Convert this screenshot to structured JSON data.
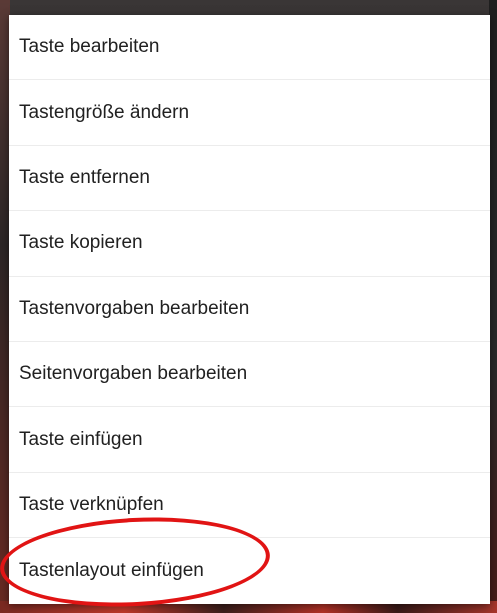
{
  "menu": {
    "items": [
      {
        "label": "Taste bearbeiten"
      },
      {
        "label": "Tastengröße ändern"
      },
      {
        "label": "Taste entfernen"
      },
      {
        "label": "Taste kopieren"
      },
      {
        "label": "Tastenvorgaben bearbeiten"
      },
      {
        "label": "Seitenvorgaben bearbeiten"
      },
      {
        "label": "Taste einfügen"
      },
      {
        "label": "Taste verknüpfen"
      },
      {
        "label": "Tastenlayout einfügen"
      }
    ]
  },
  "annotation": {
    "color": "#e11414",
    "target": "Tastenlayout einfügen"
  }
}
